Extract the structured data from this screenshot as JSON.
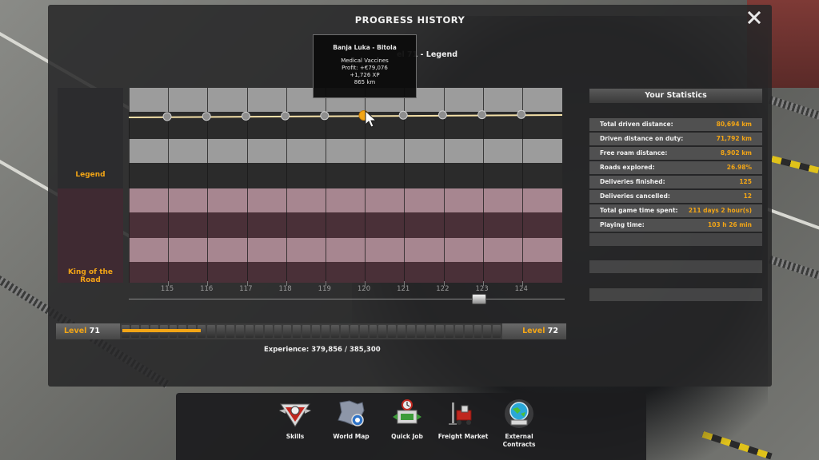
{
  "panel": {
    "title": "PROGRESS HISTORY",
    "close_icon": "close-icon"
  },
  "ranks": [
    {
      "label": "Legend"
    },
    {
      "label": "King of the Road"
    }
  ],
  "behind_tooltip_text": "el 71 - Legend",
  "x_axis": {
    "labels": [
      "115",
      "116",
      "117",
      "118",
      "119",
      "120",
      "121",
      "122",
      "123",
      "124"
    ]
  },
  "tooltip": {
    "route": "Banja Luka - Bitola",
    "cargo": "Medical Vaccines",
    "profit": "Profit: +€79,076",
    "xp": "+1,726 XP",
    "distance": "865 km"
  },
  "level_bar": {
    "current_prefix": "Level",
    "current_level": "71",
    "next_prefix": "Level",
    "next_level": "72",
    "progress_fraction": 0.208,
    "experience_text": "Experience: 379,856 / 385,300"
  },
  "statistics": {
    "title": "Your Statistics",
    "rows": [
      {
        "label": "Total driven distance:",
        "value": "80,694 km"
      },
      {
        "label": "Driven distance on duty:",
        "value": "71,792 km"
      },
      {
        "label": "Free roam distance:",
        "value": "8,902 km"
      },
      {
        "label": "Roads explored:",
        "value": "26.98%"
      },
      {
        "label": "Deliveries finished:",
        "value": "125"
      },
      {
        "label": "Deliveries cancelled:",
        "value": "12"
      },
      {
        "label": "Total game time spent:",
        "value": "211 days 2 hour(s)"
      },
      {
        "label": "Playing time:",
        "value": "103 h 26 min"
      }
    ]
  },
  "nav": [
    {
      "label": "Skills",
      "icon": "skills-emblem-icon"
    },
    {
      "label": "World Map",
      "icon": "world-map-icon"
    },
    {
      "label": "Quick Job",
      "icon": "quick-job-icon"
    },
    {
      "label": "Freight Market",
      "icon": "freight-market-icon"
    },
    {
      "label": "External Contracts",
      "icon": "external-contracts-icon"
    }
  ],
  "colors": {
    "accent": "#f2a516",
    "legend_band": "#9a9a9a",
    "king_band": "#a4858c",
    "line": "#f4e0a8"
  }
}
